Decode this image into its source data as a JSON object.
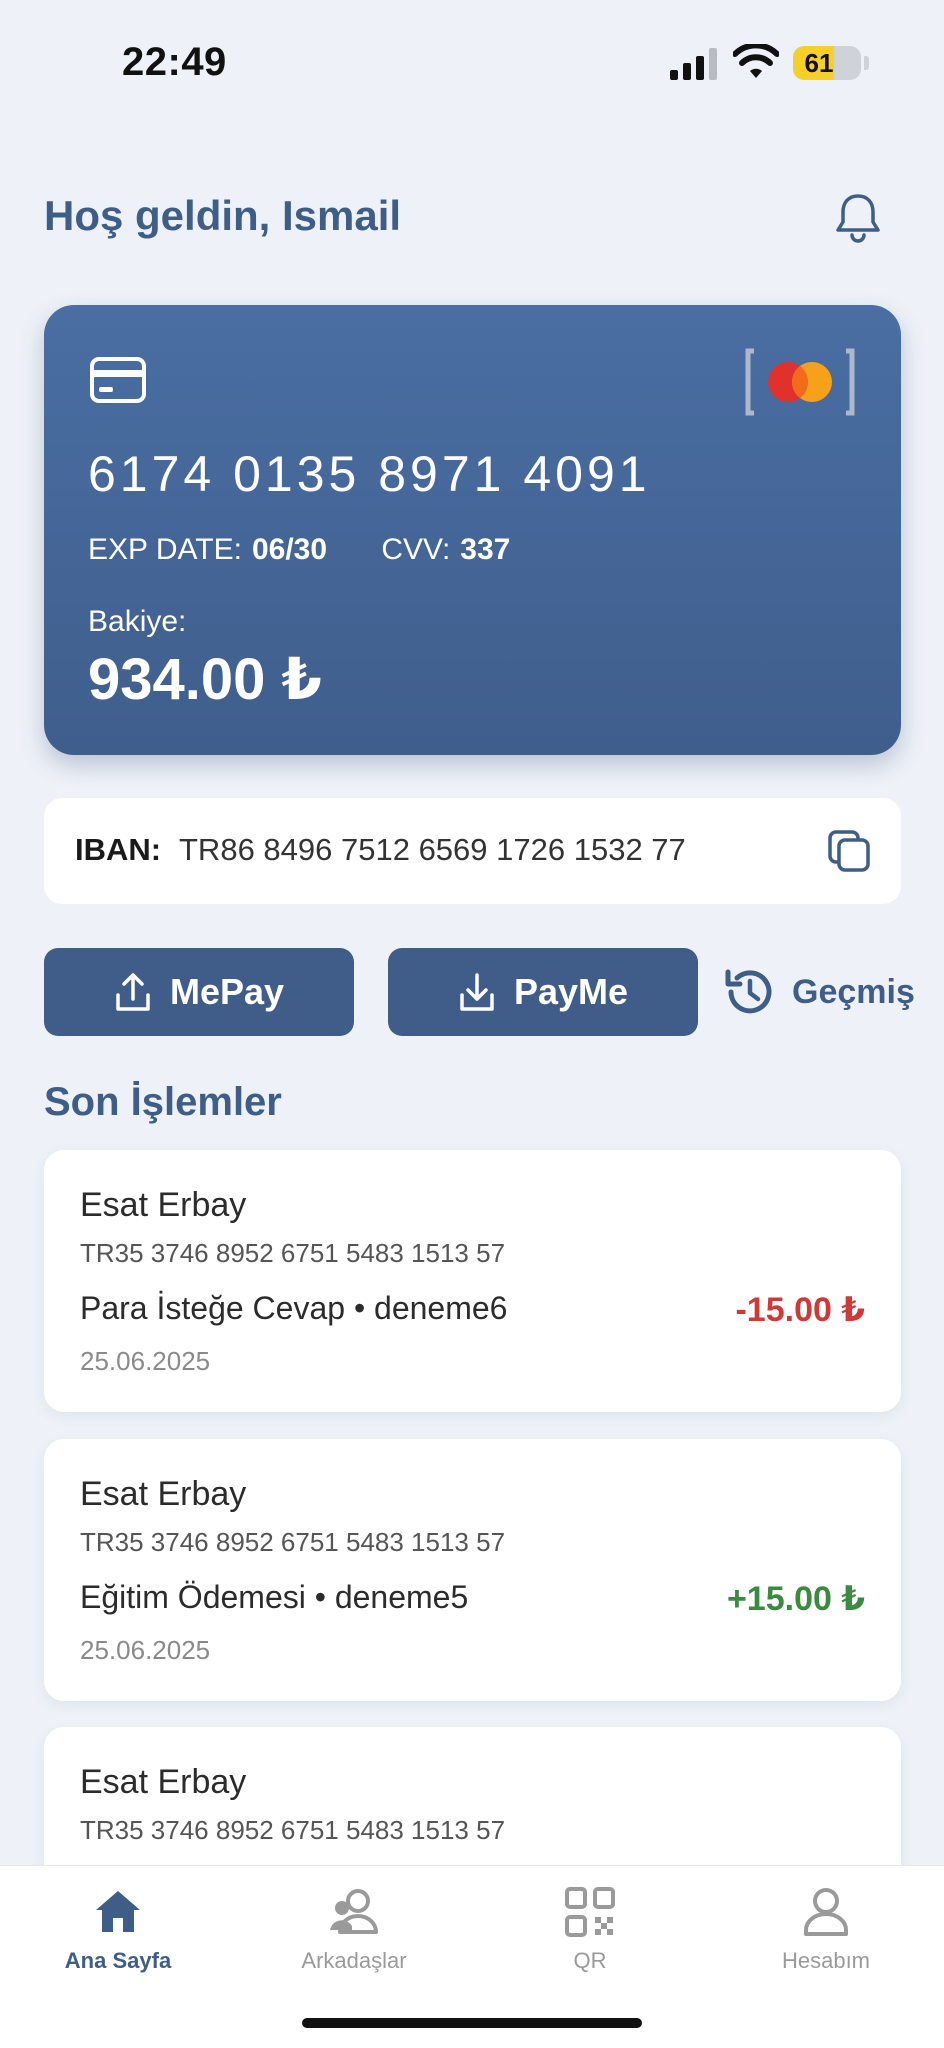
{
  "status_bar": {
    "time": "22:49",
    "battery": "61",
    "battery_level": 0.61
  },
  "header": {
    "greeting": "Hoş geldin, Ismail",
    "bell_icon": "bell-icon"
  },
  "card": {
    "number": "6174 0135 8971 4091",
    "exp_label": "EXP DATE:",
    "exp_value": "06/30",
    "cvv_label": "CVV:",
    "cvv_value": "337",
    "balance_label": "Bakiye:",
    "balance_value": "934.00 ₺",
    "card_icon": "credit-card-icon",
    "brand_logo": "mastercard-logo"
  },
  "iban": {
    "label": "IBAN:",
    "value": "TR86 8496 7512 6569 1726 1532 77",
    "copy_icon": "copy-icon"
  },
  "actions": {
    "mepay_label": "MePay",
    "payme_label": "PayMe",
    "history_label": "Geçmiş"
  },
  "transactions_title": "Son İşlemler",
  "transactions": [
    {
      "name": "Esat Erbay",
      "iban": "TR35 3746 8952 6751 5483 1513 57",
      "description": "Para İsteğe Cevap • deneme6",
      "date": "25.06.2025",
      "amount": "-15.00 ₺",
      "direction": "out"
    },
    {
      "name": "Esat Erbay",
      "iban": "TR35 3746 8952 6751 5483 1513 57",
      "description": "Eğitim Ödemesi • deneme5",
      "date": "25.06.2025",
      "amount": "+15.00 ₺",
      "direction": "in"
    },
    {
      "name": "Esat Erbay",
      "iban": "TR35 3746 8952 6751 5483 1513 57"
    }
  ],
  "tabbar": {
    "tabs": [
      {
        "label": "Ana Sayfa",
        "icon": "home-icon",
        "active": true
      },
      {
        "label": "Arkadaşlar",
        "icon": "friends-icon",
        "active": false
      },
      {
        "label": "QR",
        "icon": "qr-code-icon",
        "active": false
      },
      {
        "label": "Hesabım",
        "icon": "account-icon",
        "active": false
      }
    ]
  },
  "colors": {
    "primary": "#3e5d87",
    "background": "#eef2f8",
    "negative": "#cf3a36",
    "positive": "#3a8a3f"
  }
}
